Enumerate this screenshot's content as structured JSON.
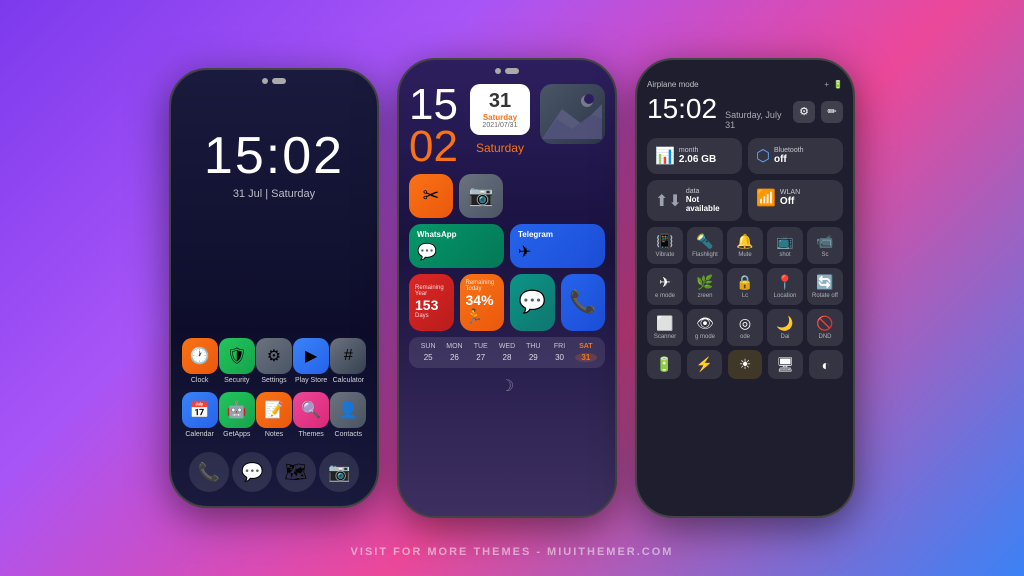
{
  "background": {
    "gradient": "linear-gradient(135deg, #7c3aed, #a855f7, #ec4899, #3b82f6)"
  },
  "watermark": {
    "text": "VISIT FOR MORE THEMES - MIUITHEMER.COM"
  },
  "phone1": {
    "time": "15:02",
    "date": "31 Jul | Saturday",
    "apps_row1": [
      {
        "label": "Clock",
        "color": "#f97316",
        "icon": "🕐"
      },
      {
        "label": "Security",
        "color": "#22c55e",
        "icon": "🛡"
      },
      {
        "label": "Settings",
        "color": "#6b7280",
        "icon": "⚙"
      },
      {
        "label": "Play Store",
        "color": "#3b82f6",
        "icon": "▶"
      },
      {
        "label": "Calculator",
        "color": "#6b7280",
        "icon": "🔢"
      }
    ],
    "apps_row2": [
      {
        "label": "Calendar",
        "color": "#3b82f6",
        "icon": "📅"
      },
      {
        "label": "GetApps",
        "color": "#22c55e",
        "icon": "🤖"
      },
      {
        "label": "Notes",
        "color": "#f97316",
        "icon": "📝"
      },
      {
        "label": "Themes",
        "color": "#ec4899",
        "icon": "🔍"
      },
      {
        "label": "Contacts",
        "color": "#6b7280",
        "icon": "👤"
      }
    ],
    "bottom_icons": [
      "📞",
      "💬",
      "🗺",
      "📷"
    ]
  },
  "phone2": {
    "hour": "15",
    "minute": "02",
    "day_number": "31",
    "weekday": "Saturday",
    "date_full": "2021/07/31",
    "saturday_label": "Saturday",
    "apps": [
      {
        "icon": "✂",
        "color": "#f97316"
      },
      {
        "icon": "📷",
        "color": "#6b7280"
      }
    ],
    "messaging": [
      {
        "name": "WhatsApp",
        "icon": "💬",
        "color": "#059669"
      },
      {
        "name": "Telegram",
        "icon": "✈",
        "color": "#2563eb"
      }
    ],
    "stats": [
      {
        "label": "Remaining Year",
        "value": "153",
        "unit": "Days",
        "color": "#dc2626"
      },
      {
        "label": "Remaining Today",
        "value": "34%",
        "unit": "",
        "color": "#f97316"
      }
    ],
    "calendar": {
      "days": [
        "SUN",
        "MON",
        "TUE",
        "WED",
        "THU",
        "FRI",
        "SAT"
      ],
      "dates": [
        "25",
        "26",
        "27",
        "28",
        "29",
        "30",
        "31"
      ]
    }
  },
  "phone3": {
    "mode": "Airplane mode",
    "time": "15:02",
    "date": "Saturday, July 31",
    "tiles": [
      {
        "title": "month",
        "value": "2.06 GB",
        "sub": "",
        "icon": "📊"
      },
      {
        "title": "Bluetooth",
        "value": "off",
        "sub": "",
        "icon": "🔵"
      }
    ],
    "tiles2": [
      {
        "title": "data",
        "value": "Not available",
        "sub": "",
        "icon": "📶"
      },
      {
        "title": "WLAN",
        "value": "Off",
        "sub": "",
        "icon": "📶"
      }
    ],
    "buttons_row1": [
      {
        "icon": "📳",
        "label": "Vibrate"
      },
      {
        "icon": "🔦",
        "label": "Flashlight"
      },
      {
        "icon": "🔔",
        "label": "Mute"
      },
      {
        "icon": "📺",
        "label": "shot"
      },
      {
        "icon": "📷",
        "label": "Sc"
      }
    ],
    "buttons_row2": [
      {
        "icon": "✈",
        "label": "e mode"
      },
      {
        "icon": "🌿",
        "label": "zreen"
      },
      {
        "icon": "📍",
        "label": "Lc"
      },
      {
        "icon": "📍",
        "label": "Location"
      },
      {
        "icon": "🔄",
        "label": "Rotate off"
      }
    ],
    "buttons_row3": [
      {
        "icon": "⬜",
        "label": "Scanner"
      },
      {
        "icon": "👁",
        "label": "g mode"
      },
      {
        "icon": "◎",
        "label": "ode"
      },
      {
        "icon": "🌙",
        "label": "Dai"
      },
      {
        "icon": "🚫",
        "label": "DND"
      }
    ],
    "bottom_controls": [
      {
        "icon": "🔋",
        "label": ""
      },
      {
        "icon": "⚡",
        "label": ""
      },
      {
        "icon": "🖥",
        "label": ""
      },
      {
        "icon": "◐",
        "label": ""
      }
    ]
  }
}
